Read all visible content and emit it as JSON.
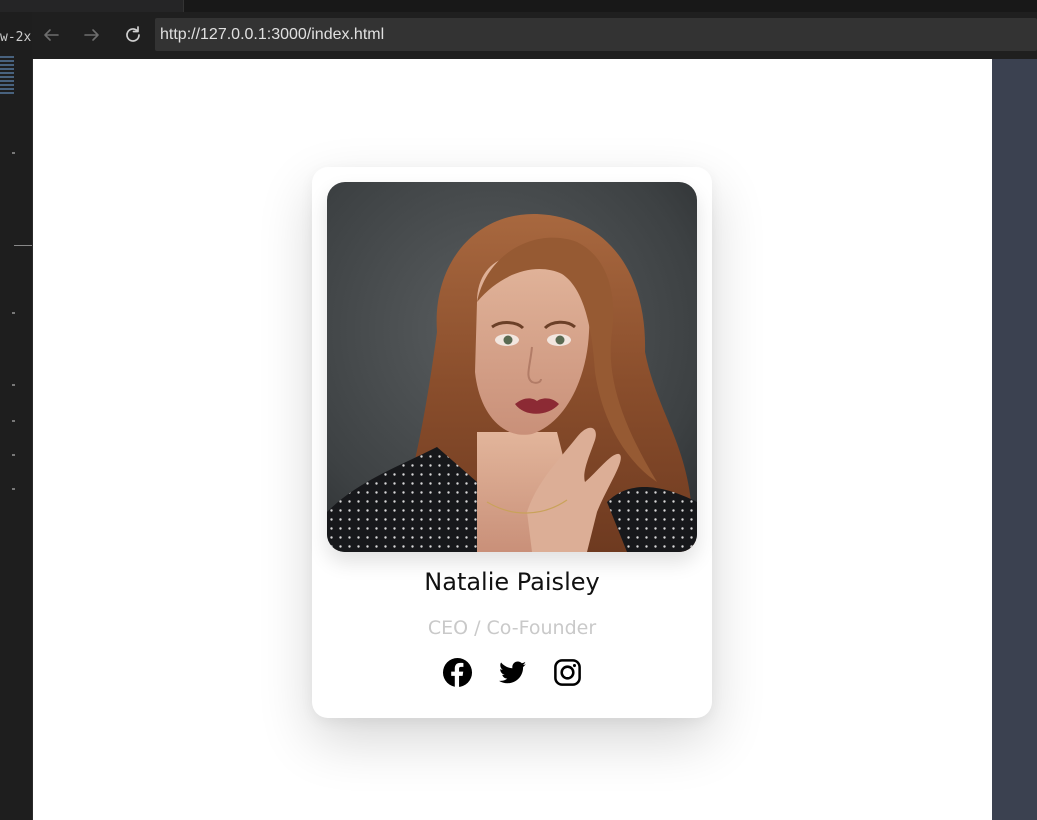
{
  "browser": {
    "url": "http://127.0.0.1:3000/index.html",
    "back_icon": "arrow-left-icon",
    "forward_icon": "arrow-right-icon",
    "reload_icon": "reload-icon"
  },
  "editor": {
    "tab_label_fragment": "w-2x"
  },
  "card": {
    "photo_icon": "portrait-photo",
    "name": "Natalie Paisley",
    "role": "CEO / Co-Founder",
    "socials": [
      {
        "name": "facebook",
        "icon": "facebook-icon"
      },
      {
        "name": "twitter",
        "icon": "twitter-icon"
      },
      {
        "name": "instagram",
        "icon": "instagram-icon"
      }
    ]
  },
  "colors": {
    "card_background": "#ffffff",
    "name_text": "#111111",
    "role_text": "#c9c9c9",
    "browser_chrome": "#1f1f1f",
    "url_box": "#333333",
    "side_panel": "#3b4150"
  }
}
